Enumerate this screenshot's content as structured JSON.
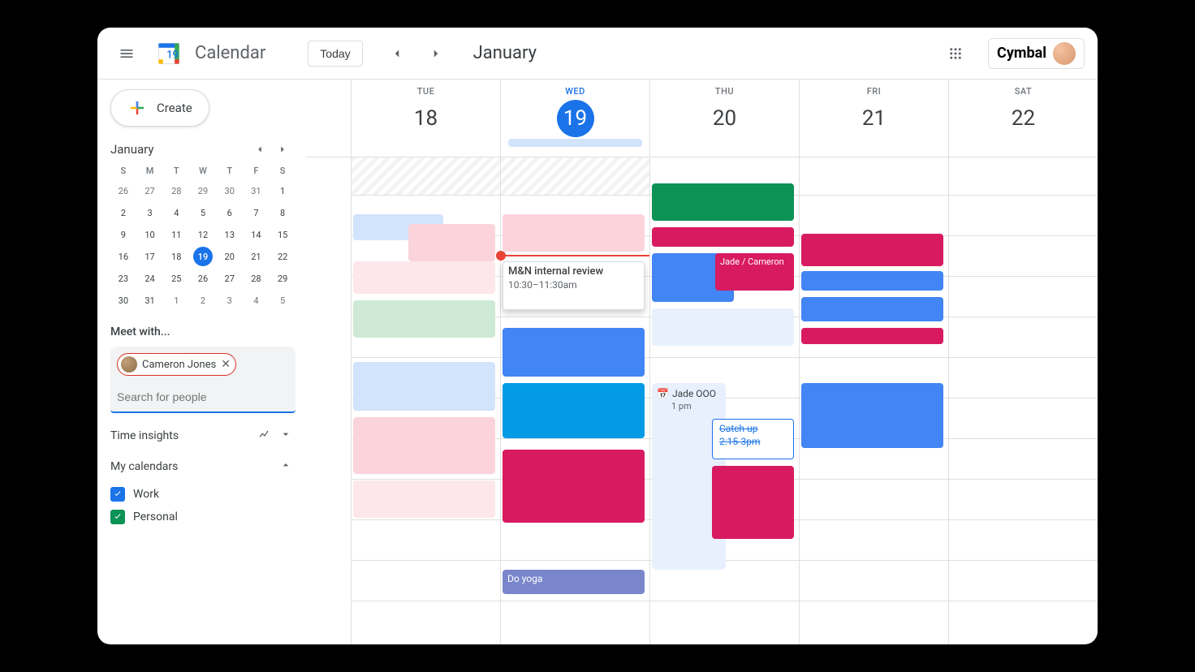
{
  "header": {
    "app_title": "Calendar",
    "today_button": "Today",
    "month_title": "January",
    "brand": "Cymbal"
  },
  "sidebar": {
    "create_label": "Create",
    "mini_month": "January",
    "dow": [
      "S",
      "M",
      "T",
      "W",
      "T",
      "F",
      "S"
    ],
    "mini_days": [
      {
        "n": "26",
        "other": true
      },
      {
        "n": "27",
        "other": true
      },
      {
        "n": "28",
        "other": true
      },
      {
        "n": "29",
        "other": true
      },
      {
        "n": "30",
        "other": true
      },
      {
        "n": "31",
        "other": true
      },
      {
        "n": "1"
      },
      {
        "n": "2"
      },
      {
        "n": "3"
      },
      {
        "n": "4"
      },
      {
        "n": "5"
      },
      {
        "n": "6"
      },
      {
        "n": "7"
      },
      {
        "n": "8"
      },
      {
        "n": "9"
      },
      {
        "n": "10"
      },
      {
        "n": "11"
      },
      {
        "n": "12"
      },
      {
        "n": "13"
      },
      {
        "n": "14"
      },
      {
        "n": "15"
      },
      {
        "n": "16"
      },
      {
        "n": "17"
      },
      {
        "n": "18"
      },
      {
        "n": "19",
        "today": true
      },
      {
        "n": "20"
      },
      {
        "n": "21"
      },
      {
        "n": "22"
      },
      {
        "n": "23"
      },
      {
        "n": "24"
      },
      {
        "n": "25"
      },
      {
        "n": "26"
      },
      {
        "n": "27"
      },
      {
        "n": "28"
      },
      {
        "n": "29"
      },
      {
        "n": "30"
      },
      {
        "n": "31"
      },
      {
        "n": "1",
        "other": true
      },
      {
        "n": "2",
        "other": true
      },
      {
        "n": "3",
        "other": true
      },
      {
        "n": "4",
        "other": true
      },
      {
        "n": "5",
        "other": true
      }
    ],
    "meet_with": "Meet with...",
    "people_chip": "Cameron Jones",
    "search_placeholder": "Search for people",
    "time_insights": "Time insights",
    "my_calendars": "My calendars",
    "calendars": [
      {
        "label": "Work",
        "color": "blue"
      },
      {
        "label": "Personal",
        "color": "green"
      }
    ]
  },
  "week": {
    "days": [
      {
        "dow": "TUE",
        "num": "18"
      },
      {
        "dow": "WED",
        "num": "19",
        "today": true
      },
      {
        "dow": "THU",
        "num": "20"
      },
      {
        "dow": "FRI",
        "num": "21"
      },
      {
        "dow": "SAT",
        "num": "22"
      }
    ]
  },
  "events": {
    "new_event_title": "M&N internal review",
    "new_event_time": "10:30–11:30am",
    "jade_cameron": "Jade / Cameron",
    "jade_ooo": "Jade OOO",
    "jade_ooo_time": "1 pm",
    "catchup_title": "Catch up",
    "catchup_time": "2:15-3pm",
    "yoga": "Do yoga"
  }
}
